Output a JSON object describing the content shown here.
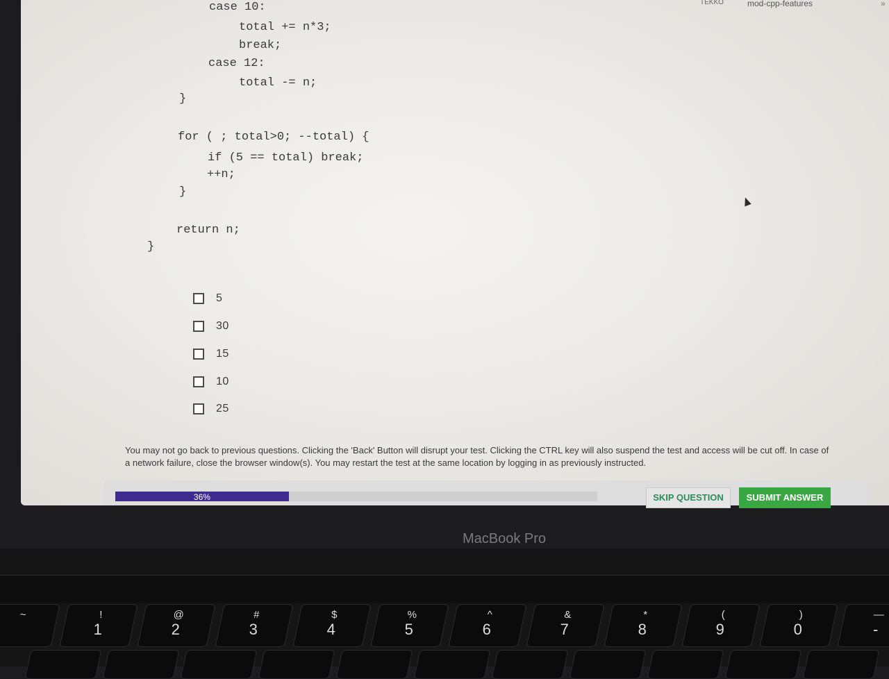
{
  "browser": {
    "bookmarks": [
      "TEKKO",
      "mod-cpp-features"
    ],
    "overflow": "»"
  },
  "code": {
    "lines": [
      "case 10:",
      "total += n*3;",
      "break;",
      "case 12:",
      "total -= n;",
      "}",
      "for ( ; total>0; --total) {",
      "if (5 == total) break;",
      "++n;",
      "}",
      "return n;",
      "}"
    ]
  },
  "question": {
    "options": [
      "5",
      "30",
      "15",
      "10",
      "25"
    ]
  },
  "notice": "You may not go back to previous questions. Clicking the 'Back' Button will disrupt your test. Clicking the CTRL key will also suspend the test and access will be cut off. In case of a network failure, close the browser window(s). You may restart the test at the same location by logging in as previously instructed.",
  "footer": {
    "progress_label": "36%",
    "progress_value": 0.36,
    "skip_label": "SKIP QUESTION",
    "submit_label": "SUBMIT ANSWER"
  },
  "device": {
    "bezel_label": "MacBook Pro"
  },
  "keyboard": {
    "keys": [
      {
        "top": "~",
        "bottom": ""
      },
      {
        "top": "!",
        "bottom": "1"
      },
      {
        "top": "@",
        "bottom": "2"
      },
      {
        "top": "#",
        "bottom": "3"
      },
      {
        "top": "$",
        "bottom": "4"
      },
      {
        "top": "%",
        "bottom": "5"
      },
      {
        "top": "^",
        "bottom": "6"
      },
      {
        "top": "&",
        "bottom": "7"
      },
      {
        "top": "*",
        "bottom": "8"
      },
      {
        "top": "(",
        "bottom": "9"
      },
      {
        "top": ")",
        "bottom": "0"
      },
      {
        "top": "—",
        "bottom": "-"
      }
    ]
  },
  "colors": {
    "progress_fill": "#3f2a8e",
    "submit_bg": "#39a843",
    "skip_text": "#2e8b57"
  }
}
